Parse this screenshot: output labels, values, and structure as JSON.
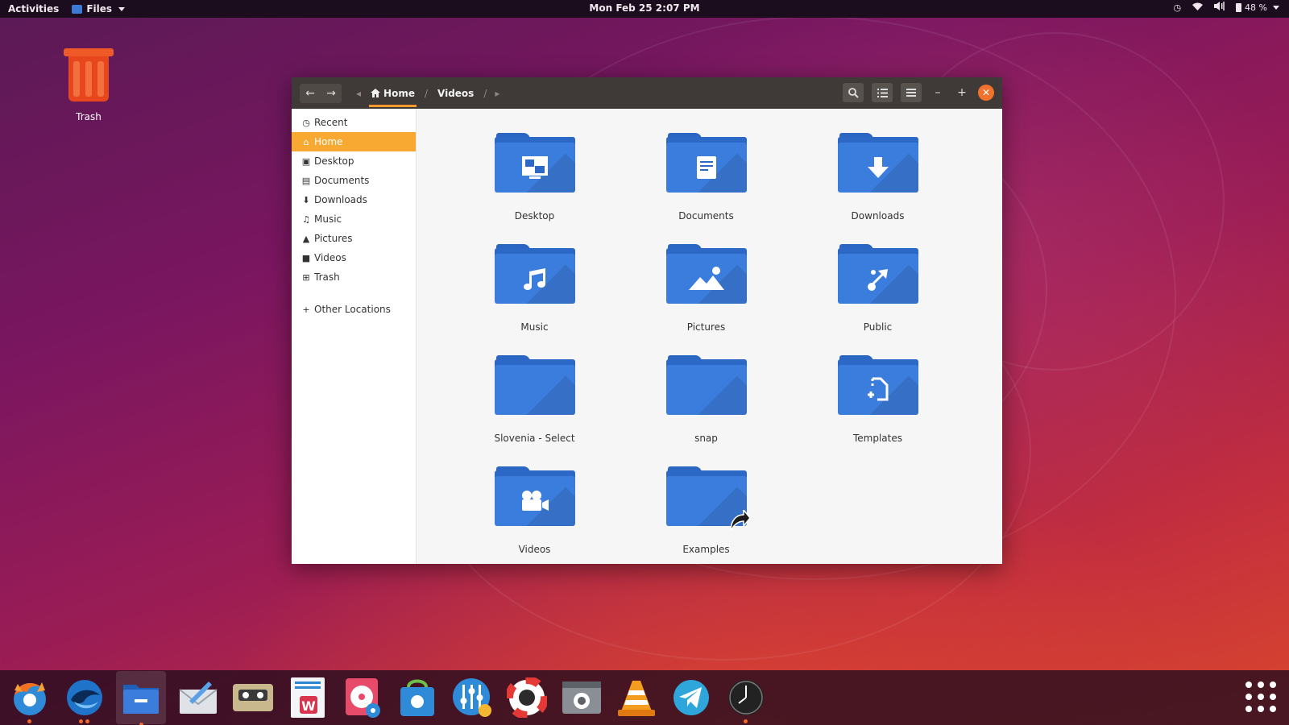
{
  "topbar": {
    "activities": "Activities",
    "app_menu": "Files",
    "datetime": "Mon Feb 25  2:07 PM",
    "battery": "48 %"
  },
  "desktop": {
    "trash_label": "Trash"
  },
  "window": {
    "breadcrumbs": [
      "Home",
      "Videos"
    ],
    "active_crumb": "Home",
    "sidebar": {
      "items": [
        {
          "label": "Recent",
          "icon": "clock-icon"
        },
        {
          "label": "Home",
          "icon": "home-icon",
          "selected": true
        },
        {
          "label": "Desktop",
          "icon": "desktop-icon"
        },
        {
          "label": "Documents",
          "icon": "document-icon"
        },
        {
          "label": "Downloads",
          "icon": "download-icon"
        },
        {
          "label": "Music",
          "icon": "headphones-icon"
        },
        {
          "label": "Pictures",
          "icon": "picture-icon"
        },
        {
          "label": "Videos",
          "icon": "camera-icon"
        },
        {
          "label": "Trash",
          "icon": "trash-icon"
        }
      ],
      "other_locations": "Other Locations"
    },
    "folders": [
      {
        "label": "Desktop",
        "icon": "desktop-icon"
      },
      {
        "label": "Documents",
        "icon": "document-icon"
      },
      {
        "label": "Downloads",
        "icon": "download-icon"
      },
      {
        "label": "Music",
        "icon": "music-note-icon"
      },
      {
        "label": "Pictures",
        "icon": "picture-icon"
      },
      {
        "label": "Public",
        "icon": "share-icon"
      },
      {
        "label": "Slovenia - Select",
        "icon": "folder-icon"
      },
      {
        "label": "snap",
        "icon": "folder-icon"
      },
      {
        "label": "Templates",
        "icon": "template-icon"
      },
      {
        "label": "Videos",
        "icon": "video-camera-icon"
      },
      {
        "label": "Examples",
        "icon": "symlink-icon"
      }
    ]
  },
  "dock": {
    "apps": [
      "firefox",
      "thunderbird",
      "files",
      "mail-composer",
      "cassette-player",
      "libreoffice-writer",
      "disk-utility",
      "software-center",
      "sound-settings",
      "help",
      "screenshot",
      "vlc",
      "telegram",
      "clock"
    ],
    "accent": "#f06a2a"
  },
  "colors": {
    "folder_blue": "#3b7ddd",
    "selection_orange": "#f7a932",
    "close_orange": "#f0722c"
  }
}
